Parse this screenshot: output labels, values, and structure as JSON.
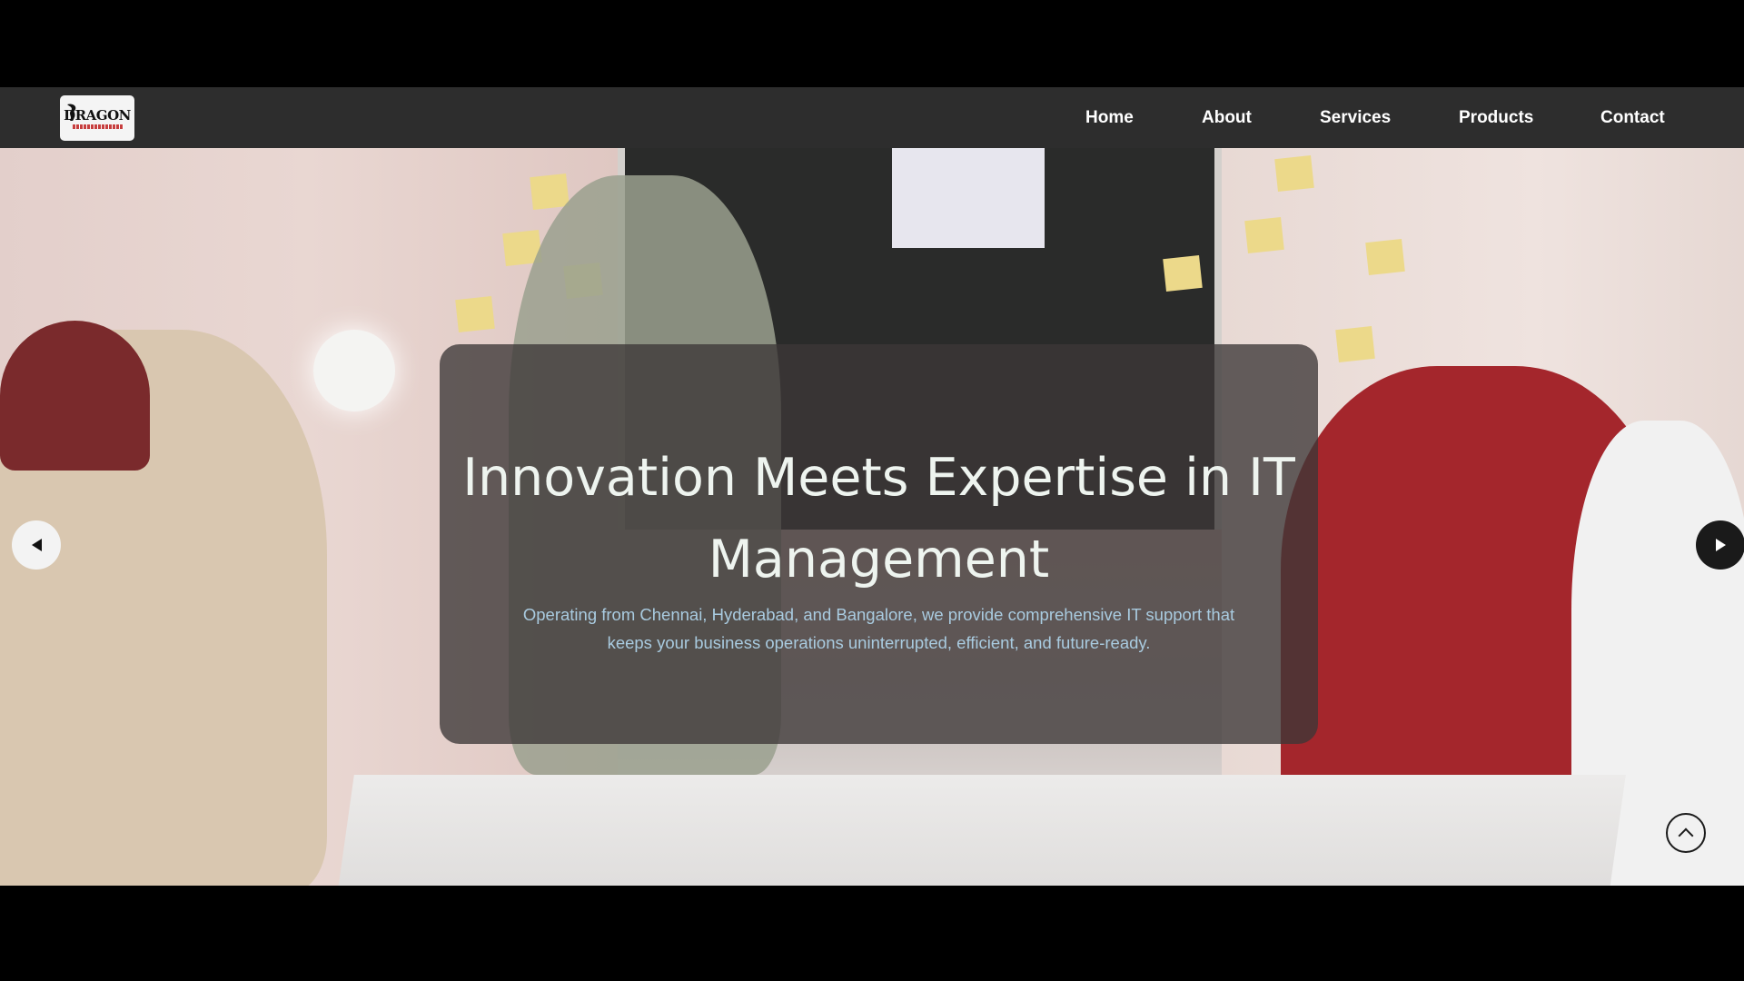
{
  "nav": {
    "logo_text": "DRAGON",
    "items": [
      {
        "label": "Home"
      },
      {
        "label": "About"
      },
      {
        "label": "Services"
      },
      {
        "label": "Products"
      },
      {
        "label": "Contact"
      }
    ]
  },
  "hero": {
    "title_line1": "Innovation Meets Expertise in IT",
    "title_line2": "Management",
    "subtitle_line1": "Operating from Chennai, Hyderabad, and Bangalore, we provide comprehensive IT support that",
    "subtitle_line2": "keeps your business operations uninterrupted, efficient, and future-ready."
  },
  "icons": {
    "prev": "arrow-left-icon",
    "next": "arrow-right-icon",
    "scroll_top": "chevron-up-icon"
  },
  "colors": {
    "nav_bg": "#2d2d2d",
    "card_bg": "rgba(60,55,55,0.78)",
    "title": "#eef4ef",
    "subtitle": "#a9cbe0"
  }
}
